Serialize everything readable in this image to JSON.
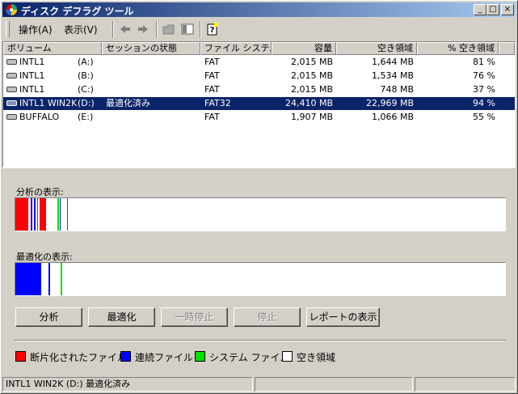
{
  "window": {
    "title": "ディスク デフラグ ツール"
  },
  "menu": {
    "action": "操作(A)",
    "view": "表示(V)"
  },
  "columns": [
    "ボリューム",
    "セッションの状態",
    "ファイル システム",
    "容量",
    "空き領域",
    "% 空き領域"
  ],
  "volumes": [
    {
      "name": "INTL1",
      "letter": "(A:)",
      "status": "",
      "fs": "FAT",
      "capacity": "2,015 MB",
      "free": "1,644 MB",
      "pct": "81 %"
    },
    {
      "name": "INTL1",
      "letter": "(B:)",
      "status": "",
      "fs": "FAT",
      "capacity": "2,015 MB",
      "free": "1,534 MB",
      "pct": "76 %"
    },
    {
      "name": "INTL1",
      "letter": "(C:)",
      "status": "",
      "fs": "FAT",
      "capacity": "2,015 MB",
      "free": "748 MB",
      "pct": "37 %"
    },
    {
      "name": "INTL1 WIN2K",
      "letter": "(D:)",
      "status": "最適化済み",
      "fs": "FAT32",
      "capacity": "24,410 MB",
      "free": "22,969 MB",
      "pct": "94 %",
      "selected": true
    },
    {
      "name": "BUFFALO",
      "letter": "(E:)",
      "status": "",
      "fs": "FAT",
      "capacity": "1,907 MB",
      "free": "1,066 MB",
      "pct": "55 %"
    }
  ],
  "analysis": {
    "label": "分析の表示:",
    "segments": [
      {
        "start": 0.0,
        "end": 0.027,
        "type": "fragmented"
      },
      {
        "start": 0.032,
        "end": 0.034,
        "type": "contiguous"
      },
      {
        "start": 0.038,
        "end": 0.041,
        "type": "contiguous"
      },
      {
        "start": 0.044,
        "end": 0.047,
        "type": "fragmented"
      },
      {
        "start": 0.049,
        "end": 0.063,
        "type": "fragmented"
      },
      {
        "start": 0.086,
        "end": 0.089,
        "type": "system"
      },
      {
        "start": 0.091,
        "end": 0.093,
        "type": "contiguous"
      },
      {
        "start": 0.105,
        "end": 0.108,
        "type": "fragmented"
      }
    ]
  },
  "defrag": {
    "label": "最適化の表示:",
    "segments": [
      {
        "start": 0.0,
        "end": 0.052,
        "type": "contiguous"
      },
      {
        "start": 0.068,
        "end": 0.071,
        "type": "contiguous"
      },
      {
        "start": 0.092,
        "end": 0.096,
        "type": "system"
      }
    ]
  },
  "buttons": {
    "analyze": "分析",
    "defragment": "最適化",
    "pause": "一時停止",
    "stop": "停止",
    "report": "レポートの表示"
  },
  "legend": {
    "fragmented": "断片化されたファイル",
    "contiguous": "連続ファイル",
    "system": "システム ファイル",
    "free": "空き領域"
  },
  "colors": {
    "fragmented": "#ff0000",
    "contiguous": "#0000ff",
    "system": "#00e000",
    "free": "#ffffff"
  },
  "statusbar": {
    "text": "INTL1 WIN2K (D:) 最適化済み"
  }
}
